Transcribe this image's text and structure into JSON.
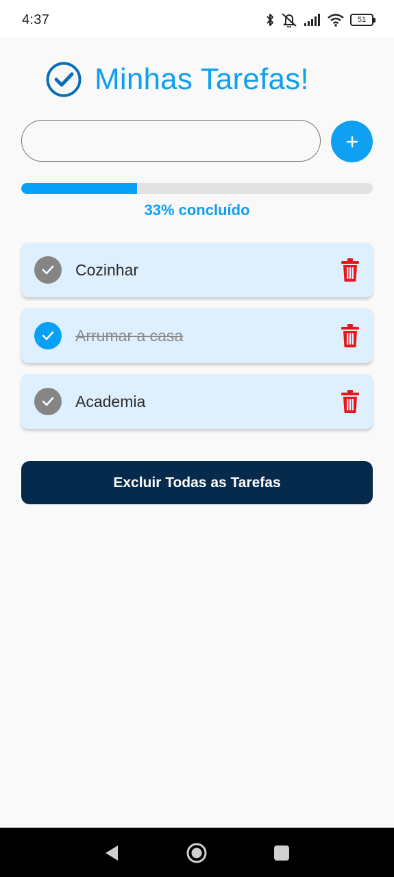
{
  "status_bar": {
    "time": "4:37",
    "battery": "51",
    "icons": [
      "bluetooth-icon",
      "muted-bell-icon",
      "signal-icon",
      "wifi-icon",
      "battery-icon"
    ]
  },
  "header": {
    "title": "Minhas Tarefas!",
    "icon": "check-circle-icon"
  },
  "input": {
    "value": "",
    "placeholder": "",
    "add_label": "+"
  },
  "progress": {
    "fraction": 0.33,
    "label": "33% concluído"
  },
  "tasks": [
    {
      "text": "Cozinhar",
      "done": false
    },
    {
      "text": "Arrumar a casa",
      "done": true
    },
    {
      "text": "Academia",
      "done": false
    }
  ],
  "delete_all_label": "Excluir Todas as Tarefas",
  "colors": {
    "accent": "#0ea0ef",
    "check_done": "#06a0f6",
    "check_pending": "#858585",
    "delete": "#e8161b",
    "danger_button": "#062a4c",
    "task_bg": "#deeffd"
  },
  "nav": [
    "back-icon",
    "home-icon",
    "recents-icon"
  ]
}
